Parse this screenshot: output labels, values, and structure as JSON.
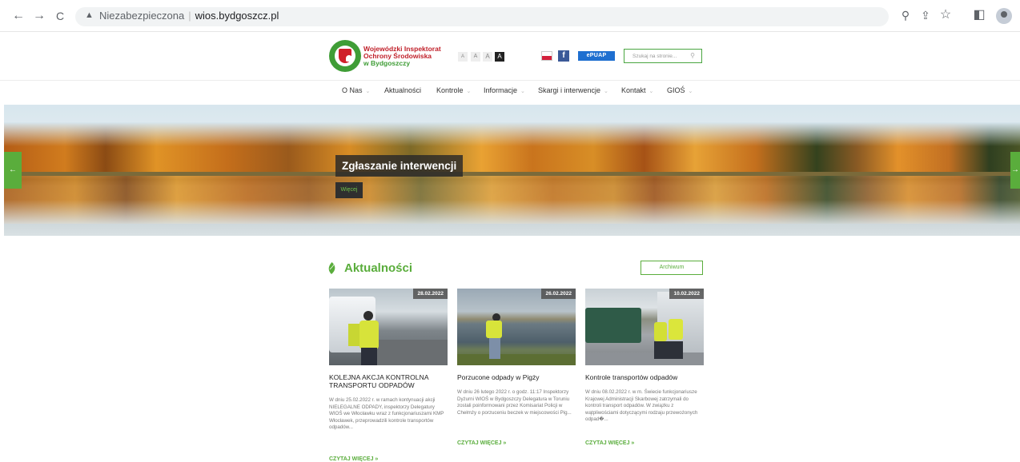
{
  "browser": {
    "warning": "Niezabezpieczona",
    "separator": "|",
    "host": "wios.bydgoszcz.pl",
    "back_icon": "←",
    "forward_icon": "→",
    "reload_icon": "C",
    "zoom_icon": "⚲",
    "share_icon": "⇪",
    "star_icon": "☆",
    "sidepanel_icon": "◧"
  },
  "logo": {
    "line1": "Wojewódzki Inspektorat",
    "line2": "Ochrony Środowiska",
    "line3": "w Bydgoszczy"
  },
  "header": {
    "font_sizes": [
      "A",
      "A",
      "A",
      "A"
    ],
    "fb_label": "f",
    "epuap_label": "ePUAP",
    "search_placeholder": "Szukaj na stronie..."
  },
  "menu": [
    {
      "label": "O Nas",
      "has_dropdown": true
    },
    {
      "label": "Aktualności",
      "has_dropdown": false
    },
    {
      "label": "Kontrole",
      "has_dropdown": true
    },
    {
      "label": "Informacje",
      "has_dropdown": true
    },
    {
      "label": "Skargi i interwencje",
      "has_dropdown": true
    },
    {
      "label": "Kontakt",
      "has_dropdown": true
    },
    {
      "label": "GIOŚ",
      "has_dropdown": true
    }
  ],
  "banner": {
    "title": "Zgłaszanie interwencji",
    "more": "Więcej",
    "prev_icon": "←",
    "next_icon": "→"
  },
  "news": {
    "title": "Aktualności",
    "archive": "Archiwum",
    "items": [
      {
        "date": "28.02.2022",
        "title": "KOLEJNA AKCJA KONTROLNA TRANSPORTU ODPADÓW",
        "excerpt": "W dniu 25.02.2022 r. w ramach kontynuacji akcji NIELEGALNE ODPADY, inspektorzy Delegatury WIOŚ we Włocławku wraz z funkcjonariuszami KMP Włocławek, przeprowadzili kontrole transportów odpadów...",
        "more": "CZYTAJ WIĘCEJ »"
      },
      {
        "date": "26.02.2022",
        "title": "Porzucone odpady w Pigży",
        "excerpt": "W dniu 26 lutego 2022 r. o godz. 11:17 Inspektorzy Dyżurni WIOŚ w Bydgoszczy Delegatura w Toruniu zostali poinformowani przez Komisariat Policji w Chełmży o porzuceniu beczek w miejscowości Pig...",
        "more": "CZYTAJ WIĘCEJ »"
      },
      {
        "date": "10.02.2022",
        "title": "Kontrole transportów odpadów",
        "excerpt": "W dniu 08.02.2022 r. w m. Świecie funkcjonariusze Krajowej Administracji Skarbowej zatrzymali do kontroli transport odpadów. W związku z wątpliwościami dotyczącymi rodzaju przewożonych odpad�...",
        "more": "CZYTAJ WIĘCEJ »"
      }
    ]
  },
  "colors": {
    "accent_green": "#5aad3c",
    "logo_red": "#c0202a",
    "epuap_blue": "#1e6fd0"
  }
}
